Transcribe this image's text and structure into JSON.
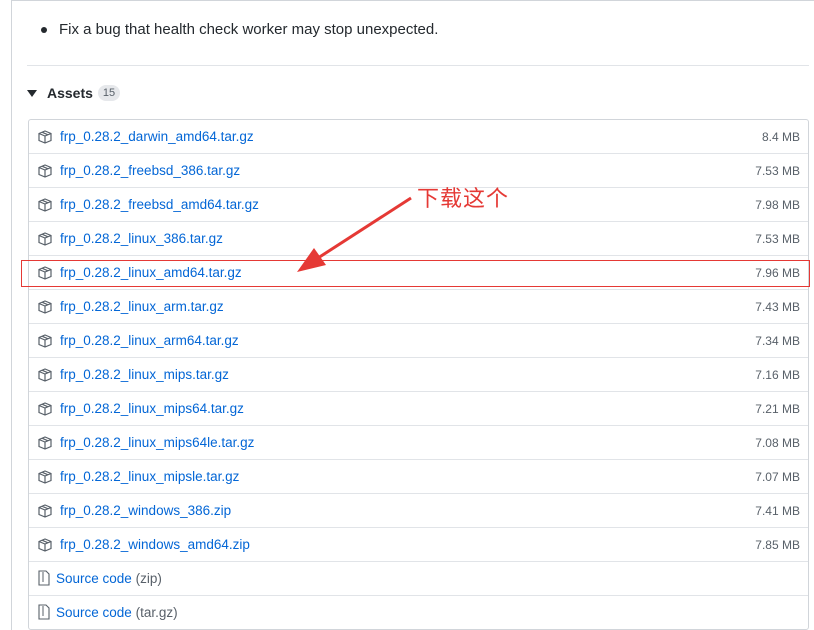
{
  "release_notes": {
    "items": [
      "Fix a bug that health check worker may stop unexpected."
    ]
  },
  "assets": {
    "title": "Assets",
    "count": "15",
    "files": [
      {
        "name": "frp_0.28.2_darwin_amd64.tar.gz",
        "size": "8.4 MB"
      },
      {
        "name": "frp_0.28.2_freebsd_386.tar.gz",
        "size": "7.53 MB"
      },
      {
        "name": "frp_0.28.2_freebsd_amd64.tar.gz",
        "size": "7.98 MB"
      },
      {
        "name": "frp_0.28.2_linux_386.tar.gz",
        "size": "7.53 MB"
      },
      {
        "name": "frp_0.28.2_linux_amd64.tar.gz",
        "size": "7.96 MB"
      },
      {
        "name": "frp_0.28.2_linux_arm.tar.gz",
        "size": "7.43 MB"
      },
      {
        "name": "frp_0.28.2_linux_arm64.tar.gz",
        "size": "7.34 MB"
      },
      {
        "name": "frp_0.28.2_linux_mips.tar.gz",
        "size": "7.16 MB"
      },
      {
        "name": "frp_0.28.2_linux_mips64.tar.gz",
        "size": "7.21 MB"
      },
      {
        "name": "frp_0.28.2_linux_mips64le.tar.gz",
        "size": "7.08 MB"
      },
      {
        "name": "frp_0.28.2_linux_mipsle.tar.gz",
        "size": "7.07 MB"
      },
      {
        "name": "frp_0.28.2_windows_386.zip",
        "size": "7.41 MB"
      },
      {
        "name": "frp_0.28.2_windows_amd64.zip",
        "size": "7.85 MB"
      }
    ],
    "source": [
      {
        "label": "Source code",
        "format": "(zip)"
      },
      {
        "label": "Source code",
        "format": "(tar.gz)"
      }
    ]
  },
  "annotation": {
    "text": "下载这个",
    "color": "#e53935"
  },
  "colors": {
    "link": "#0366d6",
    "muted": "#586069",
    "border": "#e1e4e8"
  },
  "icons": {
    "file_icon": "package-icon",
    "source_icon": "file-zip-icon",
    "caret_icon": "triangle-down-icon"
  }
}
